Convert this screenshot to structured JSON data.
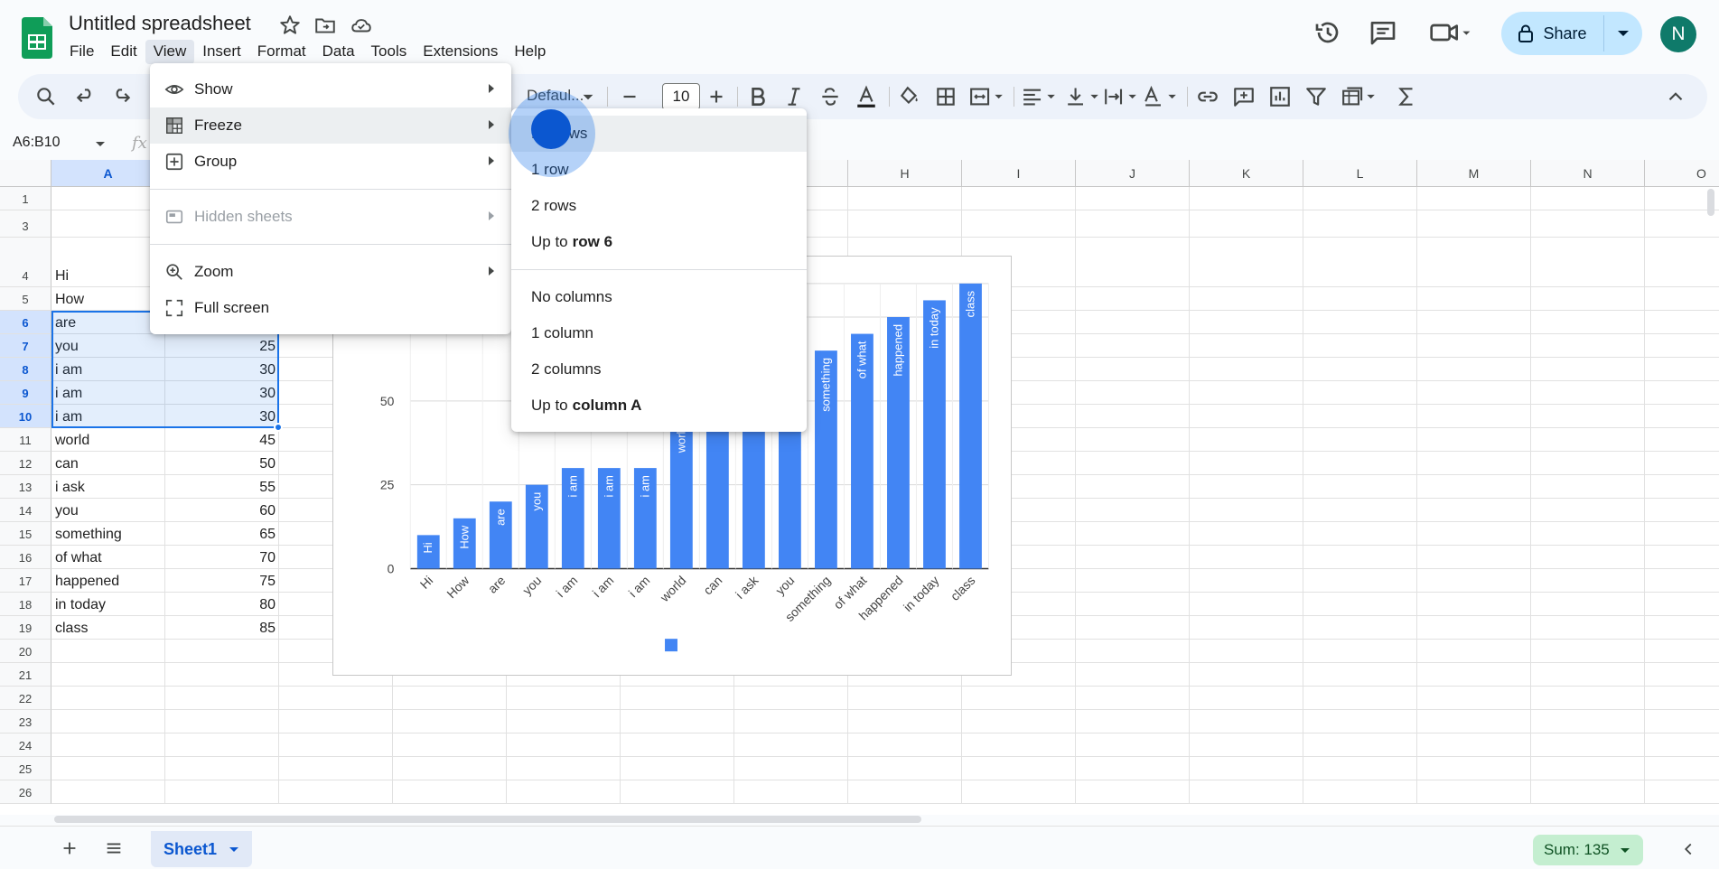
{
  "header": {
    "title": "Untitled spreadsheet",
    "menus": [
      "File",
      "Edit",
      "View",
      "Insert",
      "Format",
      "Data",
      "Tools",
      "Extensions",
      "Help"
    ],
    "share_label": "Share",
    "avatar_initial": "N"
  },
  "toolbar": {
    "font_name": "Defaul...",
    "font_size": "10"
  },
  "formula_bar": {
    "namebox": "A6:B10",
    "fx_label": "fx"
  },
  "grid": {
    "columns": [
      "A",
      "",
      "",
      "",
      "",
      "",
      "",
      "H",
      "I",
      "J",
      "K",
      "L",
      "M",
      "N",
      "O"
    ],
    "rows": [
      "1",
      "3",
      "4",
      "5",
      "6",
      "7",
      "8",
      "9",
      "10",
      "11",
      "12",
      "13",
      "14",
      "15",
      "16",
      "17",
      "18",
      "19",
      "20",
      "21",
      "22",
      "23",
      "24",
      "25",
      "26"
    ],
    "cells": [
      {
        "row": "4",
        "a": "Hi",
        "b": ""
      },
      {
        "row": "5",
        "a": "How",
        "b": ""
      },
      {
        "row": "6",
        "a": "are",
        "b": ""
      },
      {
        "row": "7",
        "a": "you",
        "b": "25"
      },
      {
        "row": "8",
        "a": "i am",
        "b": "30"
      },
      {
        "row": "9",
        "a": "i am",
        "b": "30"
      },
      {
        "row": "10",
        "a": "i am",
        "b": "30"
      },
      {
        "row": "11",
        "a": "world",
        "b": "45"
      },
      {
        "row": "12",
        "a": "can",
        "b": "50"
      },
      {
        "row": "13",
        "a": "i ask",
        "b": "55"
      },
      {
        "row": "14",
        "a": "you",
        "b": "60"
      },
      {
        "row": "15",
        "a": "something",
        "b": "65"
      },
      {
        "row": "16",
        "a": "of what",
        "b": "70"
      },
      {
        "row": "17",
        "a": "happened",
        "b": "75"
      },
      {
        "row": "18",
        "a": "in today",
        "b": "80"
      },
      {
        "row": "19",
        "a": "class",
        "b": "85"
      }
    ]
  },
  "view_menu": {
    "items": [
      {
        "label": "Show",
        "icon": "eye-icon",
        "submenu": true,
        "disabled": false
      },
      {
        "label": "Freeze",
        "icon": "freeze-icon",
        "submenu": true,
        "disabled": false
      },
      {
        "label": "Group",
        "icon": "group-icon",
        "submenu": true,
        "disabled": false
      },
      {
        "label": "Hidden sheets",
        "icon": "hidden-sheets-icon",
        "submenu": true,
        "disabled": true
      },
      {
        "label": "Zoom",
        "icon": "zoom-icon",
        "submenu": true,
        "disabled": false
      },
      {
        "label": "Full screen",
        "icon": "fullscreen-icon",
        "submenu": false,
        "disabled": false
      }
    ]
  },
  "freeze_menu": {
    "no_rows": "No rows",
    "one_row": "1 row",
    "two_rows": "2 rows",
    "up_to_row_prefix": "Up to",
    "up_to_row_bold": "row 6",
    "no_columns": "No columns",
    "one_column": "1 column",
    "two_columns": "2 columns",
    "up_to_col_prefix": "Up to",
    "up_to_col_bold": "column A"
  },
  "bottom": {
    "sheet_name": "Sheet1",
    "sum_label": "Sum: 135"
  },
  "colors": {
    "accent": "#1a73e8",
    "bar": "#4285f4",
    "share_bg": "#c2e7ff",
    "sum_bg": "#c4eed0"
  },
  "chart_data": {
    "type": "bar",
    "categories": [
      "Hi",
      "How",
      "are",
      "you",
      "i am",
      "i am",
      "i am",
      "world",
      "can",
      "i ask",
      "you",
      "something",
      "of what",
      "happened",
      "in today",
      "class"
    ],
    "values": [
      10,
      15,
      20,
      25,
      30,
      30,
      30,
      45,
      50,
      55,
      60,
      65,
      70,
      75,
      80,
      85
    ],
    "y_ticks": [
      "0",
      "25",
      "50",
      "75"
    ],
    "ylim": [
      0,
      85
    ],
    "grid": true,
    "legend": "bottom"
  }
}
